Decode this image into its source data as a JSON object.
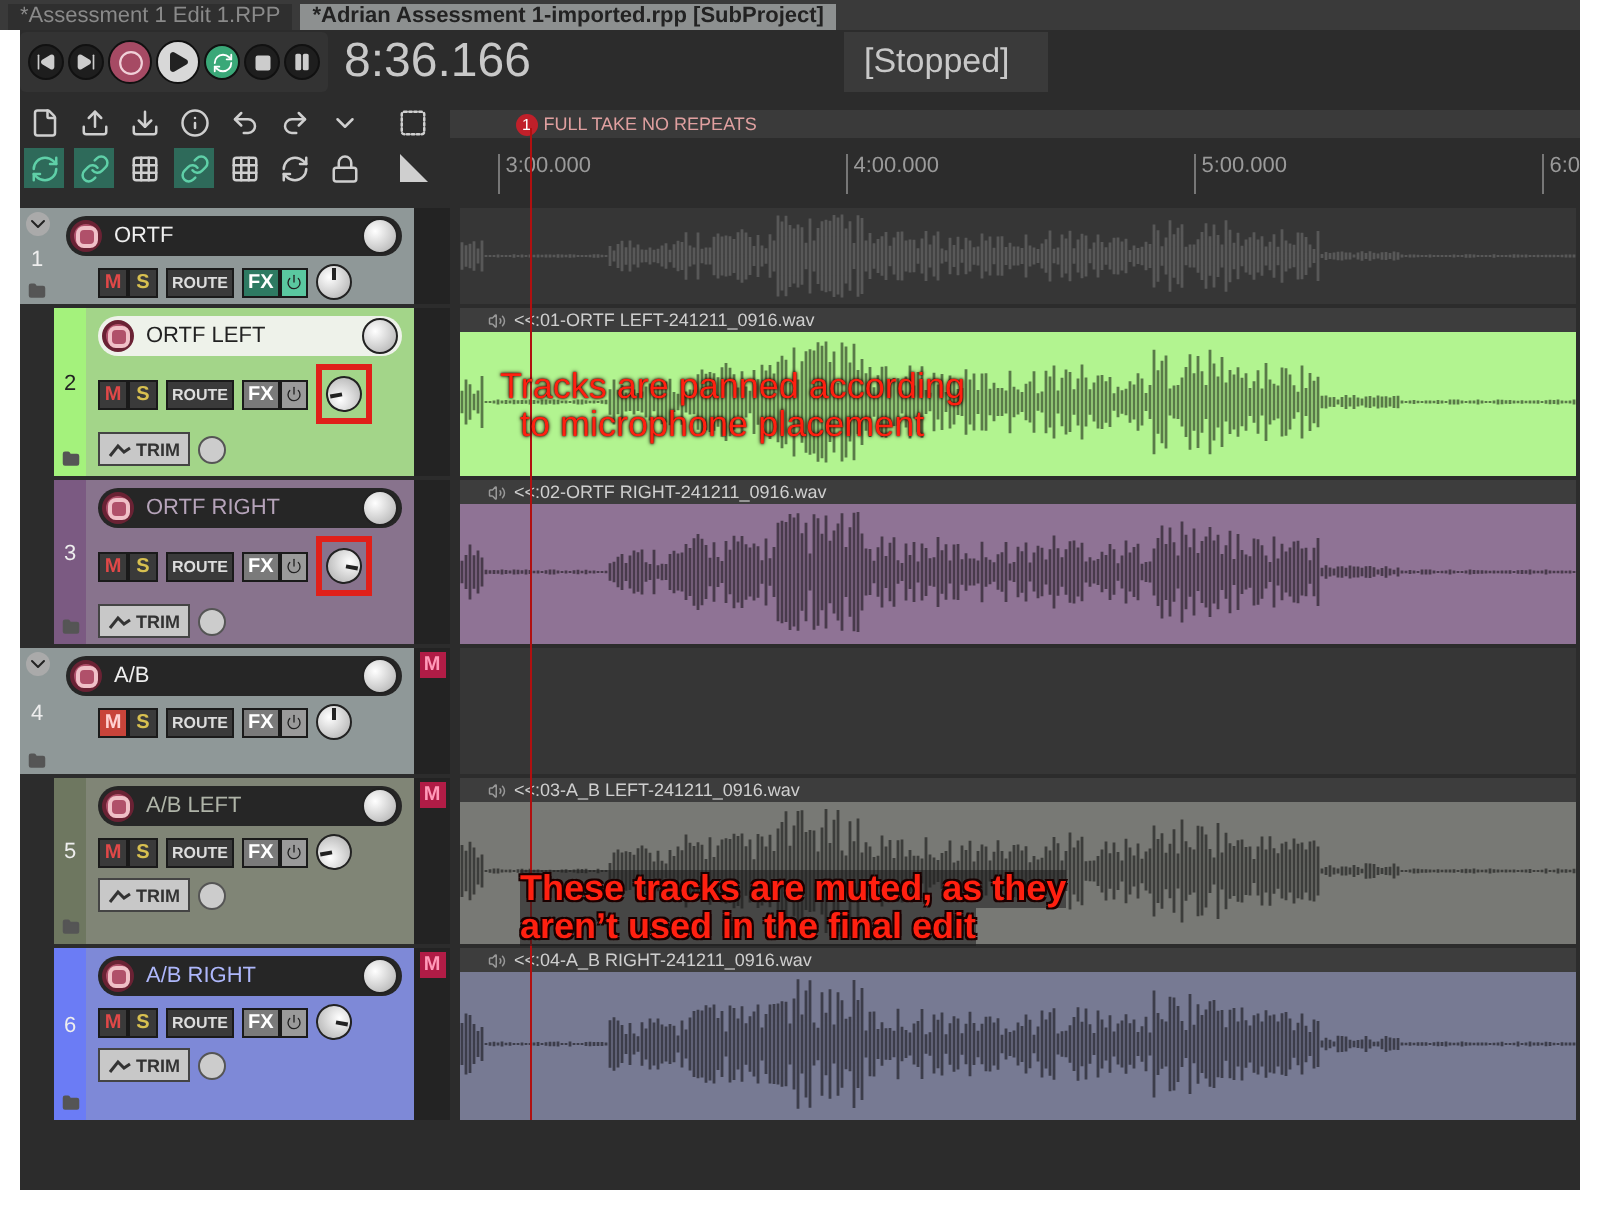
{
  "tabs": [
    {
      "label": "*Assessment 1 Edit  1.RPP",
      "selected": false
    },
    {
      "label": "*Adrian Assessment 1-imported.rpp [SubProject]",
      "selected": true
    }
  ],
  "transport": {
    "time": "8:36.166",
    "status": "[Stopped]",
    "repeat": true
  },
  "toolbar_toggles": [
    {
      "on": true
    },
    {
      "on": true
    },
    {
      "on": false
    },
    {
      "on": true
    },
    {
      "on": false
    },
    {
      "on": false
    },
    {
      "on": false
    }
  ],
  "marker": {
    "number": "1",
    "label": "FULL TAKE NO REPEATS"
  },
  "ruler": [
    "3:00.000",
    "4:00.000",
    "5:00.000",
    "6:0"
  ],
  "tracks": [
    {
      "number": "1",
      "name": "ORTF",
      "kind": "folder",
      "color": "#8f9898",
      "selected": false,
      "muted": false,
      "fx_on": true,
      "pan_left": false,
      "pan_right": false,
      "annotated": false,
      "buttons": {
        "mute": "M",
        "solo": "S",
        "route": "ROUTE",
        "fx": "FX"
      }
    },
    {
      "number": "2",
      "name": "ORTF LEFT",
      "kind": "child",
      "color": "#a4f27c",
      "selected": true,
      "muted": false,
      "fx_on": false,
      "pan_left": true,
      "pan_right": false,
      "annotated": true,
      "buttons": {
        "mute": "M",
        "solo": "S",
        "route": "ROUTE",
        "fx": "FX",
        "trim": "TRIM"
      },
      "item": "<<:01-ORTF LEFT-241211_0916.wav"
    },
    {
      "number": "3",
      "name": "ORTF RIGHT",
      "kind": "child",
      "color": "#7b5a82",
      "selected": false,
      "muted": false,
      "fx_on": false,
      "pan_left": false,
      "pan_right": true,
      "annotated": true,
      "buttons": {
        "mute": "M",
        "solo": "S",
        "route": "ROUTE",
        "fx": "FX",
        "trim": "TRIM"
      },
      "item": "<<:02-ORTF RIGHT-241211_0916.wav"
    },
    {
      "number": "4",
      "name": "A/B",
      "kind": "folder",
      "color": "#8f9898",
      "selected": false,
      "muted": true,
      "mute_flag": "M",
      "fx_on": false,
      "pan_left": false,
      "pan_right": false,
      "annotated": false,
      "buttons": {
        "mute": "M",
        "solo": "S",
        "route": "ROUTE",
        "fx": "FX"
      }
    },
    {
      "number": "5",
      "name": "A/B LEFT",
      "kind": "child",
      "color": "#6e7760",
      "selected": false,
      "muted": false,
      "mute_flag": "M",
      "fx_on": false,
      "pan_left": true,
      "pan_right": false,
      "annotated": false,
      "buttons": {
        "mute": "M",
        "solo": "S",
        "route": "ROUTE",
        "fx": "FX",
        "trim": "TRIM"
      },
      "item": "<<:03-A_B LEFT-241211_0916.wav"
    },
    {
      "number": "6",
      "name": "A/B RIGHT",
      "kind": "child",
      "color": "#6b7cf5",
      "selected": false,
      "muted": false,
      "mute_flag": "M",
      "fx_on": false,
      "pan_left": false,
      "pan_right": true,
      "annotated": false,
      "buttons": {
        "mute": "M",
        "solo": "S",
        "route": "ROUTE",
        "fx": "FX",
        "trim": "TRIM"
      },
      "item": "<<:04-A_B RIGHT-241211_0916.wav"
    }
  ],
  "annotations": [
    {
      "lines": [
        "Tracks are panned according",
        "to microphone placement"
      ]
    },
    {
      "lines": [
        "These tracks are muted, as they",
        "aren’t used in the final edit"
      ]
    }
  ]
}
